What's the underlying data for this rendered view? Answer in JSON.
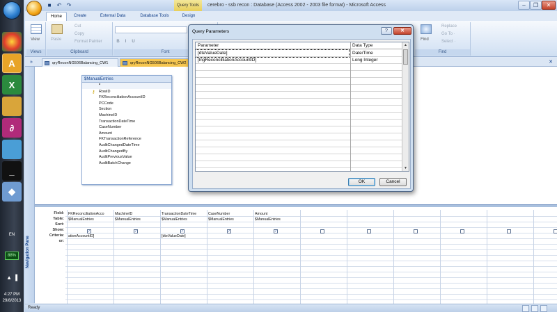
{
  "window": {
    "title": "cerebro - ssb recon : Database (Access 2002 - 2003 file format) - Microsoft Access",
    "context_tab": "Query Tools",
    "controls": [
      "–",
      "❐",
      "✕"
    ]
  },
  "ribbon": {
    "tabs": [
      "Home",
      "Create",
      "External Data",
      "Database Tools",
      "Design"
    ],
    "groups": {
      "views": {
        "label": "Views",
        "view_button": "View"
      },
      "clipboard": {
        "label": "Clipboard",
        "paste": "Paste",
        "cut": "Cut",
        "copy": "Copy",
        "format_painter": "Format Painter"
      },
      "font": {
        "label": "Font"
      },
      "find": {
        "label": "Find",
        "find_button": "Find",
        "replace": "Replace",
        "go_to": "Go To ·",
        "select": "Select ·"
      }
    }
  },
  "doc_tabs": [
    "qryReconNG506Balancing_CW1",
    "qryReconNG506Balancing_CW2"
  ],
  "navigation_pane": {
    "label": "Navigation Pane"
  },
  "field_list": {
    "title": "$ManualEntries",
    "fields": [
      "*",
      "RowID",
      "FKReconciliationAccountID",
      "PCCode",
      "Section",
      "MachineID",
      "TransactionDateTime",
      "CaseNumber",
      "Amount",
      "FKTransactionReference",
      "AuditChangedDateTime",
      "AuditChangedBy",
      "AuditPreviousValue",
      "AuditBatchChange"
    ]
  },
  "qbe": {
    "row_labels": [
      "Field:",
      "Table:",
      "Sort:",
      "Show:",
      "Criteria:",
      "or:"
    ],
    "columns": [
      {
        "field": "FKReconciliationAcco",
        "table": "$ManualEntries",
        "show": true,
        "criteria": "ationAccountID]"
      },
      {
        "field": "MachineID",
        "table": "$ManualEntries",
        "show": true,
        "criteria": ""
      },
      {
        "field": "TransactionDateTime",
        "table": "$ManualEntries",
        "show": true,
        "criteria": "[dteValueDate]"
      },
      {
        "field": "CaseNumber",
        "table": "$ManualEntries",
        "show": true,
        "criteria": ""
      },
      {
        "field": "Amount",
        "table": "$ManualEntries",
        "show": true,
        "criteria": ""
      },
      {
        "field": "",
        "table": "",
        "show": false,
        "criteria": ""
      },
      {
        "field": "",
        "table": "",
        "show": false,
        "criteria": ""
      },
      {
        "field": "",
        "table": "",
        "show": false,
        "criteria": ""
      },
      {
        "field": "",
        "table": "",
        "show": false,
        "criteria": ""
      },
      {
        "field": "",
        "table": "",
        "show": false,
        "criteria": ""
      },
      {
        "field": "",
        "table": "",
        "show": false,
        "criteria": ""
      }
    ]
  },
  "dialog": {
    "title": "Query Parameters",
    "help_button": "?",
    "close_button": "✕",
    "headers": {
      "parameter": "Parameter",
      "data_type": "Data Type"
    },
    "rows": [
      {
        "parameter": "[dteValueDate]",
        "data_type": "Date/Time"
      },
      {
        "parameter": "[lngReconcilliationAccountID]",
        "data_type": "Long Integer"
      }
    ],
    "ok": "OK",
    "cancel": "Cancel"
  },
  "status_bar": {
    "text": "Ready"
  },
  "taskbar": {
    "language": "EN",
    "battery": "88%",
    "time": "4:27 PM",
    "date": "29/8/2013"
  }
}
